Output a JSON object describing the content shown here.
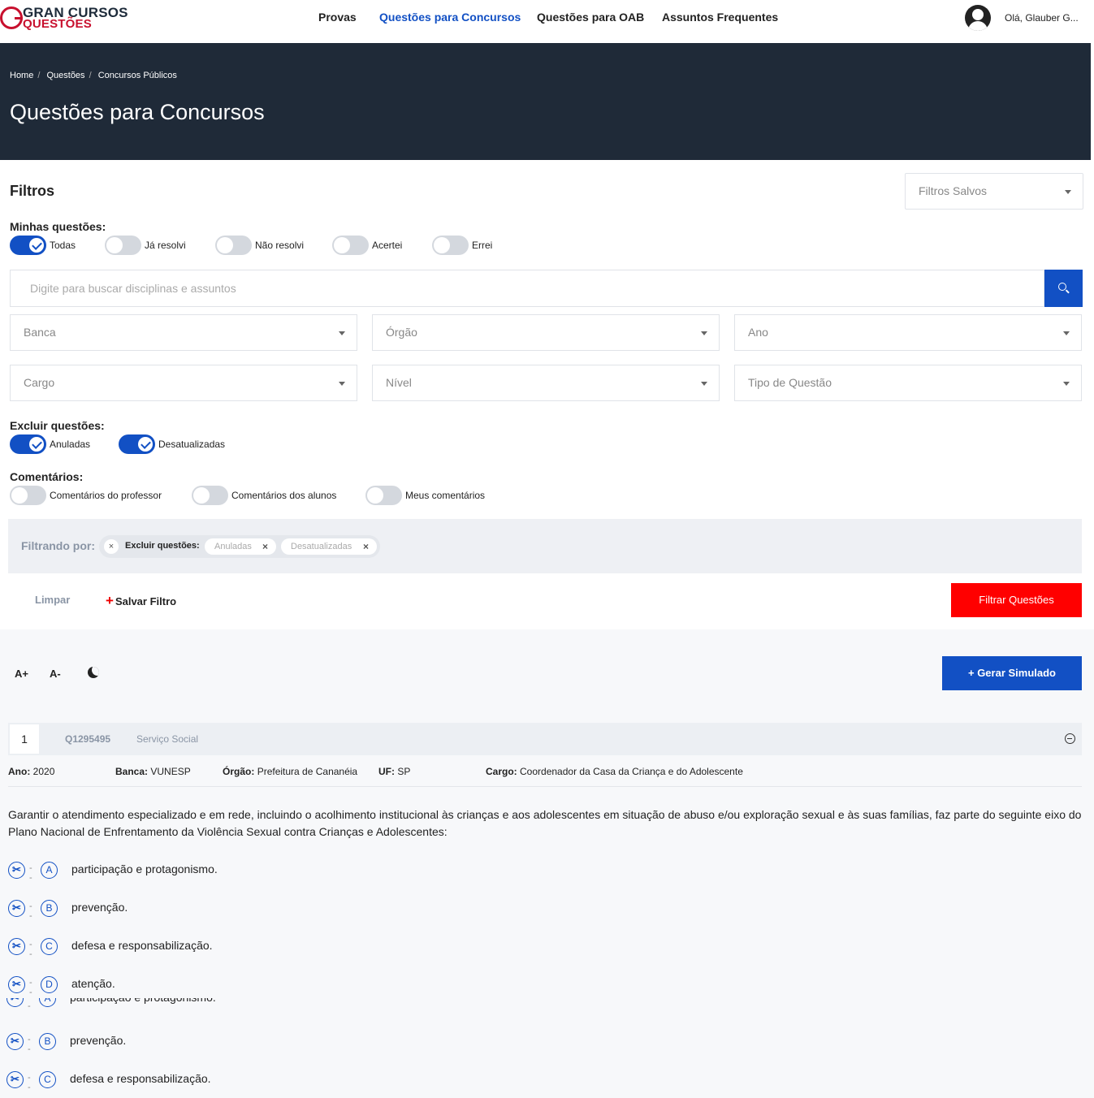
{
  "brand": {
    "line1": "GRAN CURSOS",
    "line2": "QUESTÕES"
  },
  "nav": {
    "items": [
      "Provas",
      "Questões para Concursos",
      "Questões para OAB",
      "Assuntos Frequentes"
    ],
    "user": "Olá, Glauber G..."
  },
  "breadcrumb": [
    "Home",
    "Questões",
    "Concursos Públicos"
  ],
  "page_title": "Questões para Concursos",
  "filters": {
    "title": "Filtros",
    "saved_placeholder": "Filtros Salvos",
    "minhas_label": "Minhas questões:",
    "minhas": [
      {
        "label": "Todas",
        "on": true
      },
      {
        "label": "Já resolvi",
        "on": false
      },
      {
        "label": "Não resolvi",
        "on": false
      },
      {
        "label": "Acertei",
        "on": false
      },
      {
        "label": "Errei",
        "on": false
      }
    ],
    "search_placeholder": "Digite para buscar disciplinas e assuntos",
    "selects": [
      "Banca",
      "Órgão",
      "Ano",
      "Cargo",
      "Nível",
      "Tipo de Questão"
    ],
    "excluir_label": "Excluir questões:",
    "excluir": [
      {
        "label": "Anuladas",
        "on": true
      },
      {
        "label": "Desatualizadas",
        "on": true
      }
    ],
    "comentarios_label": "Comentários:",
    "comentarios": [
      {
        "label": "Comentários do professor",
        "on": false
      },
      {
        "label": "Comentários dos alunos",
        "on": false
      },
      {
        "label": "Meus comentários",
        "on": false
      }
    ],
    "filtrando_label": "Filtrando por:",
    "chip_group_label": "Excluir questões:",
    "chips": [
      "Anuladas",
      "Desatualizadas"
    ],
    "clear": "Limpar",
    "save": "Salvar Filtro",
    "submit": "Filtrar Questões"
  },
  "toolbar": {
    "font_up": "A+",
    "font_down": "A-",
    "simulado": "+ Gerar Simulado"
  },
  "question": {
    "number": "1",
    "id": "Q1295495",
    "subject": "Serviço Social",
    "meta": [
      {
        "k": "Ano:",
        "v": "2020"
      },
      {
        "k": "Banca:",
        "v": "VUNESP"
      },
      {
        "k": "Órgão:",
        "v": "Prefeitura de Cananéia"
      },
      {
        "k": "UF:",
        "v": "SP"
      },
      {
        "k": "Cargo:",
        "v": "Coordenador da Casa da Criança e do Adolescente"
      }
    ],
    "statement": "Garantir o atendimento especializado e em rede, incluindo o acolhimento institucional às crianças e aos adolescentes em situação de abuso e/ou exploração sexual e às suas famílias, faz parte do seguinte eixo do Plano Nacional de Enfrentamento da Violência Sexual contra Crianças e Adolescentes:",
    "alternatives": [
      {
        "letter": "A",
        "text": "participação e protagonismo."
      },
      {
        "letter": "B",
        "text": "prevenção."
      },
      {
        "letter": "C",
        "text": "defesa e responsabilização."
      },
      {
        "letter": "D",
        "text": "atenção."
      }
    ]
  },
  "colors": {
    "primary": "#1250c4",
    "danger": "#ff0000",
    "hero": "#1f2a38"
  }
}
